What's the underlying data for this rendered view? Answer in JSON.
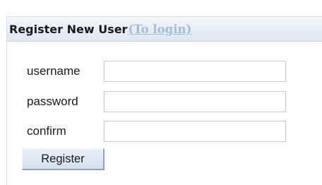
{
  "header": {
    "title": "Register New User",
    "login_link": "(To login)"
  },
  "form": {
    "username": {
      "label": "username",
      "value": ""
    },
    "password": {
      "label": "password",
      "value": ""
    },
    "confirm": {
      "label": "confirm",
      "value": ""
    },
    "submit_label": "Register"
  },
  "colors": {
    "header_background": "#dde6f2",
    "link": "#a6bcd3",
    "button_border": "#8aa4c2"
  }
}
